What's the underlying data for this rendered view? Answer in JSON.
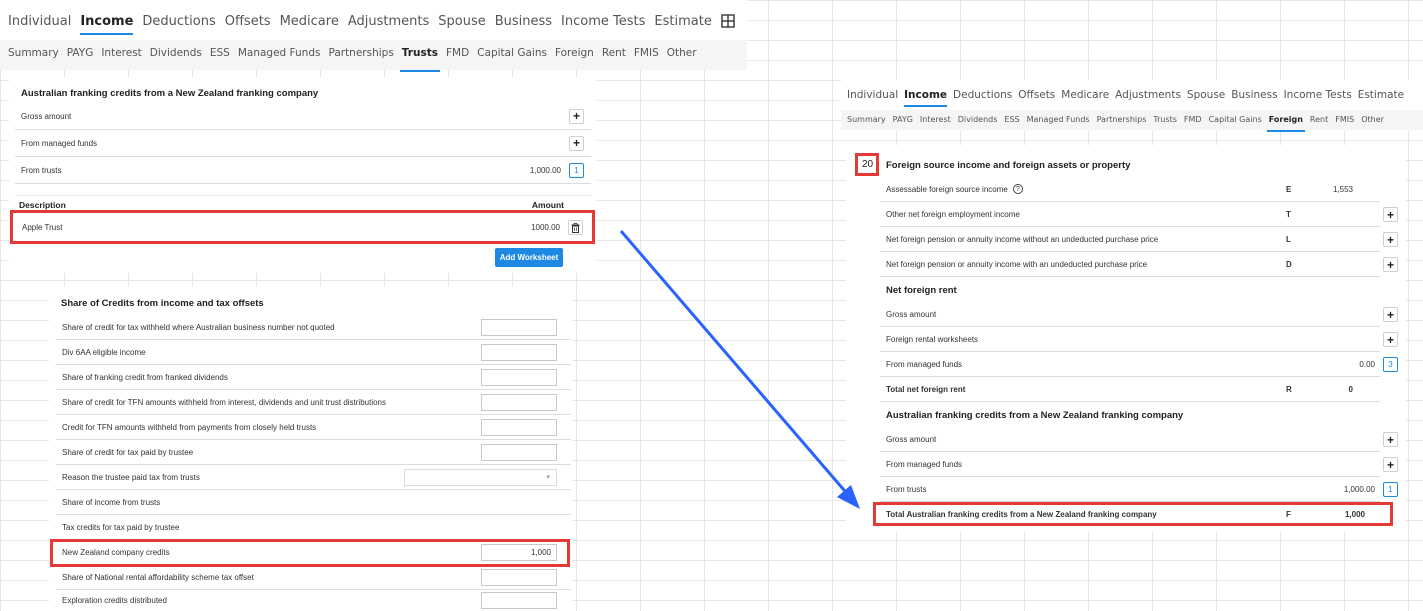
{
  "colors": {
    "accent": "#1e88e5",
    "highlight": "#e53935",
    "arrow": "#2962ff"
  },
  "nav": {
    "main_tabs": [
      "Individual",
      "Income",
      "Deductions",
      "Offsets",
      "Medicare",
      "Adjustments",
      "Spouse",
      "Business",
      "Income Tests",
      "Estimate"
    ],
    "main_active": "Income",
    "sub_tabs": [
      "Summary",
      "PAYG",
      "Interest",
      "Dividends",
      "ESS",
      "Managed Funds",
      "Partnerships",
      "Trusts",
      "FMD",
      "Capital Gains",
      "Foreign",
      "Rent",
      "FMIS",
      "Other"
    ],
    "left_sub_active": "Trusts",
    "right_sub_active": "Foreign",
    "layout_icon": "grid-icon"
  },
  "nz_left": {
    "title": "Australian franking credits from a New Zealand franking company",
    "rows": [
      {
        "label": "Gross amount"
      },
      {
        "label": "From managed funds"
      },
      {
        "label": "From trusts",
        "value": "1,000.00",
        "count": "1"
      }
    ],
    "table_header": {
      "description": "Description",
      "amount": "Amount"
    },
    "worksheet_row": {
      "description": "Apple Trust",
      "amount": "1000.00"
    },
    "add_worksheet_label": "Add Worksheet",
    "delete_icon": "trash-icon"
  },
  "share_credits": {
    "title": "Share of Credits from income and tax offsets",
    "rows": [
      {
        "label": "Share of credit for tax withheld where Australian business number not quoted",
        "input": ""
      },
      {
        "label": "Div 6AA eligible income",
        "input": ""
      },
      {
        "label": "Share of franking credit from franked dividends",
        "input": ""
      },
      {
        "label": "Share of credit for TFN amounts withheld from interest, dividends and unit trust distributions",
        "input": ""
      },
      {
        "label": "Credit for TFN amounts withheld from payments from closely held trusts",
        "input": ""
      },
      {
        "label": "Share of credit for tax paid by trustee",
        "input": ""
      },
      {
        "label": "Reason the trustee paid tax from trusts",
        "select": ""
      },
      {
        "label": "Share of income from trusts"
      },
      {
        "label": "Tax credits for tax paid by trustee"
      },
      {
        "label": "New Zealand company credits",
        "input": "1,000"
      },
      {
        "label": "Share of National rental affordability scheme tax offset",
        "input": ""
      },
      {
        "label": "Exploration credits distributed",
        "input": ""
      }
    ]
  },
  "foreign": {
    "section_number": "20",
    "title": "Foreign source income and foreign assets or property",
    "rows": [
      {
        "label": "Assessable foreign source income",
        "code": "E",
        "value": "1,553",
        "help_icon": "help-circle-icon"
      },
      {
        "label": "Other net foreign employment income",
        "code": "T"
      },
      {
        "label": "Net foreign pension or annuity income without an undeducted purchase price",
        "code": "L"
      },
      {
        "label": "Net foreign pension or annuity income with an undeducted purchase price",
        "code": "D"
      }
    ],
    "rent": {
      "title": "Net foreign rent",
      "rows": [
        {
          "label": "Gross amount"
        },
        {
          "label": "Foreign rental worksheets"
        },
        {
          "label": "From managed funds",
          "value": "0.00",
          "count": "3"
        },
        {
          "label": "Total net foreign rent",
          "code": "R",
          "value": "0"
        }
      ]
    },
    "nz": {
      "title": "Australian franking credits from a New Zealand franking company",
      "rows": [
        {
          "label": "Gross amount"
        },
        {
          "label": "From managed funds"
        },
        {
          "label": "From trusts",
          "value": "1,000.00",
          "count": "1"
        },
        {
          "label": "Total Australian franking credits from a New Zealand franking company",
          "code": "F",
          "value": "1,000"
        }
      ]
    }
  }
}
